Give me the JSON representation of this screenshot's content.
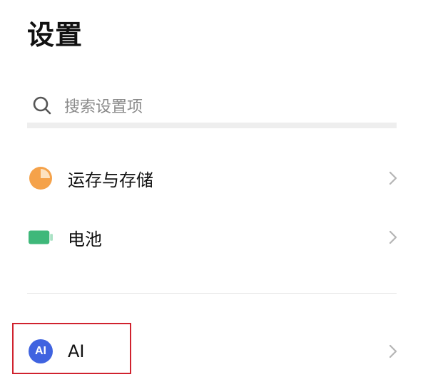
{
  "header": {
    "title": "设置"
  },
  "search": {
    "placeholder": "搜索设置项",
    "icon": "search-icon"
  },
  "settings": {
    "storage": {
      "label": "运存与存储",
      "icon": "pie-chart-icon",
      "icon_color": "#f5a24a"
    },
    "battery": {
      "label": "电池",
      "icon": "battery-icon",
      "icon_color": "#3fb87a"
    },
    "ai": {
      "label": "AI",
      "icon_text": "AI",
      "icon": "ai-badge-icon",
      "icon_color": "#3f63e0"
    }
  },
  "highlight": {
    "color": "#d0222e"
  }
}
